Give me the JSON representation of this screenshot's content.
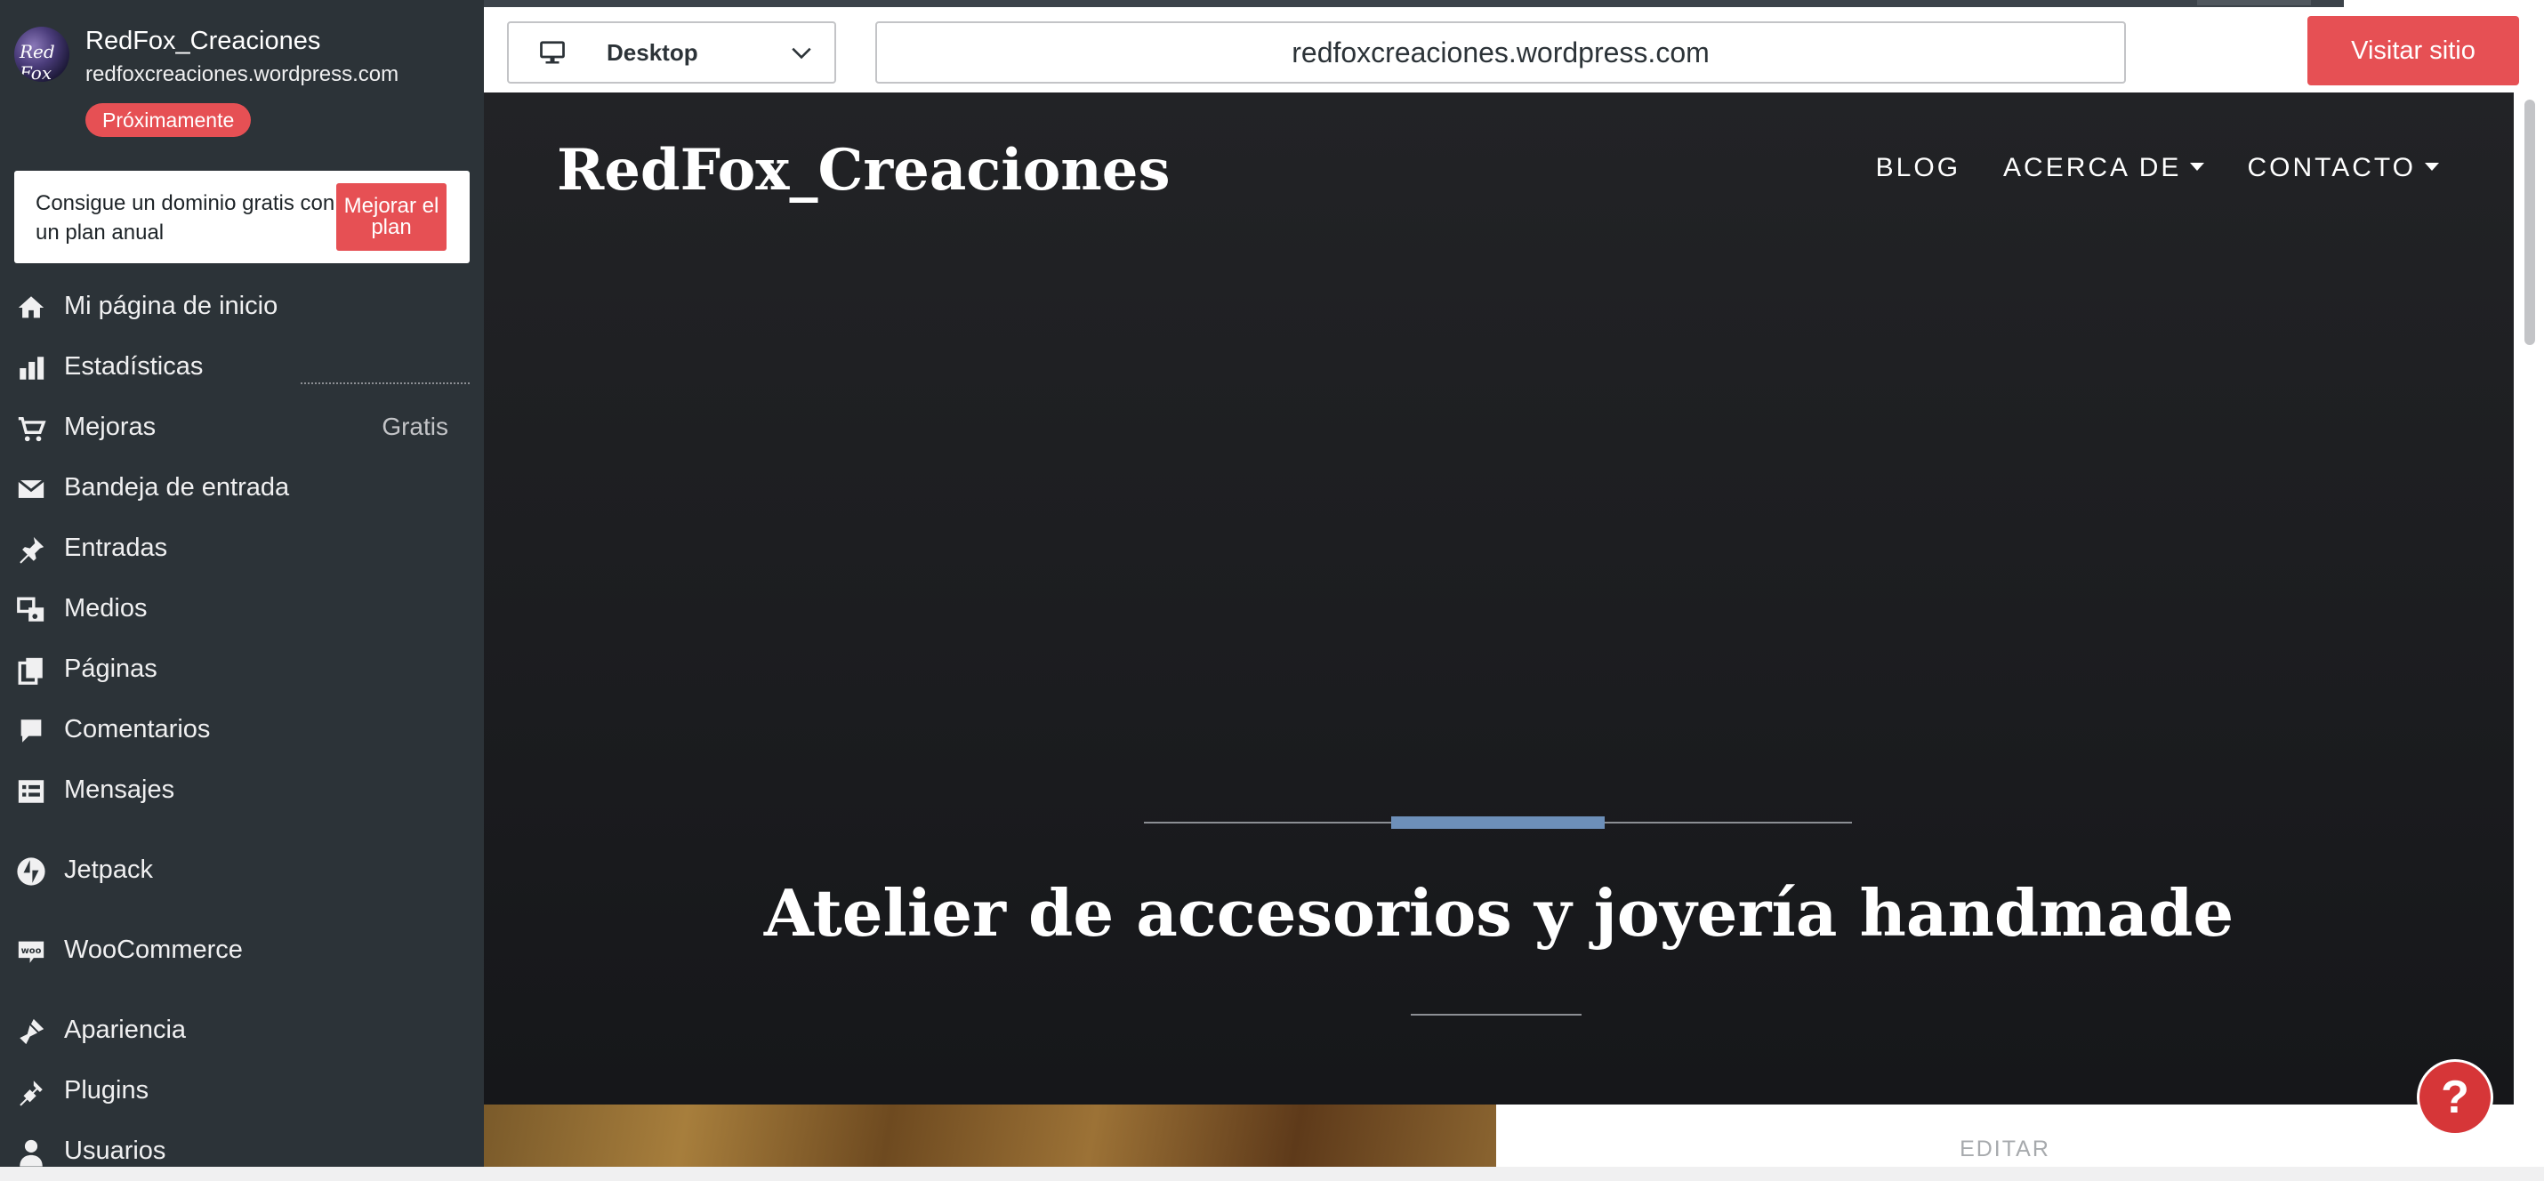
{
  "site": {
    "name": "RedFox_Creaciones",
    "url": "redfoxcreaciones.wordpress.com",
    "status_badge": "Próximamente",
    "avatar_text": "Red Fox"
  },
  "upgrade": {
    "text": "Consigue un dominio gratis con un plan anual",
    "button": "Mejorar el plan"
  },
  "menu": [
    {
      "label": "Mi página de inicio",
      "icon": "home-icon"
    },
    {
      "label": "Estadísticas",
      "icon": "stats-icon"
    },
    {
      "label": "Mejoras",
      "icon": "cart-icon",
      "extra": "Gratis"
    },
    {
      "label": "Bandeja de entrada",
      "icon": "mail-icon"
    },
    {
      "label": "Entradas",
      "icon": "pin-icon"
    },
    {
      "label": "Medios",
      "icon": "media-icon"
    },
    {
      "label": "Páginas",
      "icon": "pages-icon"
    },
    {
      "label": "Comentarios",
      "icon": "comment-icon"
    },
    {
      "label": "Mensajes",
      "icon": "feedback-icon"
    },
    {
      "label": "Jetpack",
      "icon": "jetpack-icon"
    },
    {
      "label": "WooCommerce",
      "icon": "woo-icon"
    },
    {
      "label": "Apariencia",
      "icon": "brush-icon"
    },
    {
      "label": "Plugins",
      "icon": "plugin-icon"
    },
    {
      "label": "Usuarios",
      "icon": "user-icon"
    }
  ],
  "toolbar": {
    "device": "Desktop",
    "url": "redfoxcreaciones.wordpress.com",
    "visit": "Visitar sitio"
  },
  "preview": {
    "brand": "RedFox_Creaciones",
    "nav": [
      {
        "label": "BLOG",
        "dropdown": false
      },
      {
        "label": "ACERCA DE",
        "dropdown": true
      },
      {
        "label": "CONTACTO",
        "dropdown": true
      }
    ],
    "tagline": "Atelier de accesorios y joyería handmade",
    "edit": "EDITAR"
  },
  "help": "?",
  "colors": {
    "sidebar": "#2c3338",
    "accent": "#e65054",
    "preview_bg": "#1c1d20",
    "rule_accent": "#6d8fb9"
  }
}
